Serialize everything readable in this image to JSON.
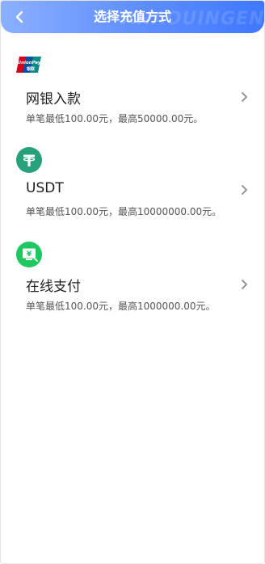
{
  "header": {
    "title": "选择充值方式",
    "watermark": "ANAOUINGEN"
  },
  "methods": [
    {
      "name": "网银入款",
      "limit": "单笔最低100.00元，最高50000.00元。",
      "icon": "unionpay-icon",
      "icon_text": "UnionPay 银联",
      "icon_color": "#d6001c"
    },
    {
      "name": "USDT",
      "limit": "单笔最低100.00元，最高10000000.00元。",
      "icon": "tether-icon",
      "icon_color": "#26a17b"
    },
    {
      "name": "在线支付",
      "limit": "单笔最低100.00元，最高1000000.00元。",
      "icon": "online-payment-icon",
      "icon_color": "#1ec75f"
    }
  ],
  "colors": {
    "header_start": "#8bb0ff",
    "header_end": "#3f78ff",
    "text_primary": "#1e1e1e",
    "text_secondary": "#555555",
    "chevron": "#8a8a8a"
  }
}
